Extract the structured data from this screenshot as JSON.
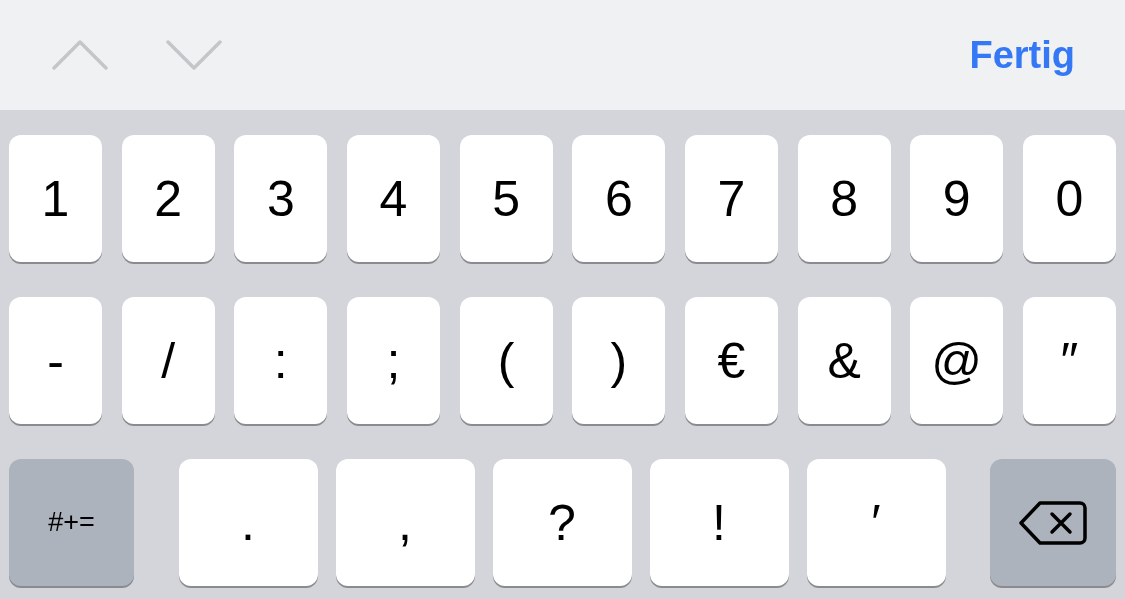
{
  "toolbar": {
    "nav_buttons": [
      {
        "kind": "previous",
        "disabled": true
      },
      {
        "kind": "next",
        "disabled": true
      }
    ],
    "done_label": "Fertig"
  },
  "keyboard": {
    "rows": [
      {
        "kind": "digits",
        "keys": [
          {
            "kind": "char",
            "label": "1"
          },
          {
            "kind": "char",
            "label": "2"
          },
          {
            "kind": "char",
            "label": "3"
          },
          {
            "kind": "char",
            "label": "4"
          },
          {
            "kind": "char",
            "label": "5"
          },
          {
            "kind": "char",
            "label": "6"
          },
          {
            "kind": "char",
            "label": "7"
          },
          {
            "kind": "char",
            "label": "8"
          },
          {
            "kind": "char",
            "label": "9"
          },
          {
            "kind": "char",
            "label": "0"
          }
        ]
      },
      {
        "kind": "symbols",
        "keys": [
          {
            "kind": "char",
            "label": "-"
          },
          {
            "kind": "char",
            "label": "/"
          },
          {
            "kind": "char",
            "label": ":"
          },
          {
            "kind": "char",
            "label": ";"
          },
          {
            "kind": "char",
            "label": "("
          },
          {
            "kind": "char",
            "label": ")"
          },
          {
            "kind": "char",
            "label": "€"
          },
          {
            "kind": "char",
            "label": "&"
          },
          {
            "kind": "char",
            "label": "@"
          },
          {
            "kind": "char",
            "label": "″"
          }
        ]
      },
      {
        "kind": "bottom",
        "keys": [
          {
            "kind": "mode",
            "label": "#+="
          },
          {
            "kind": "char",
            "label": "."
          },
          {
            "kind": "char",
            "label": ","
          },
          {
            "kind": "char",
            "label": "?"
          },
          {
            "kind": "char",
            "label": "!"
          },
          {
            "kind": "char",
            "label": "′"
          },
          {
            "kind": "delete"
          }
        ]
      }
    ]
  }
}
